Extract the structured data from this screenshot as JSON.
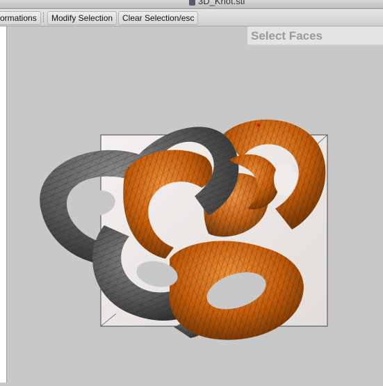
{
  "window": {
    "title": "3D_Knot.stl"
  },
  "toolbar": {
    "items": [
      {
        "label": "ormations"
      },
      {
        "label": "Modify Selection"
      },
      {
        "label": "Clear Selection/esc"
      }
    ]
  },
  "mode": {
    "label": "Select Faces"
  },
  "viewport": {
    "model": "3D_Knot.stl",
    "colors": {
      "background": "#c8c8c8",
      "grey_mesh": "#555555",
      "orange_mesh": "#c65f0c",
      "bounding_box": "#ede8e6"
    }
  }
}
